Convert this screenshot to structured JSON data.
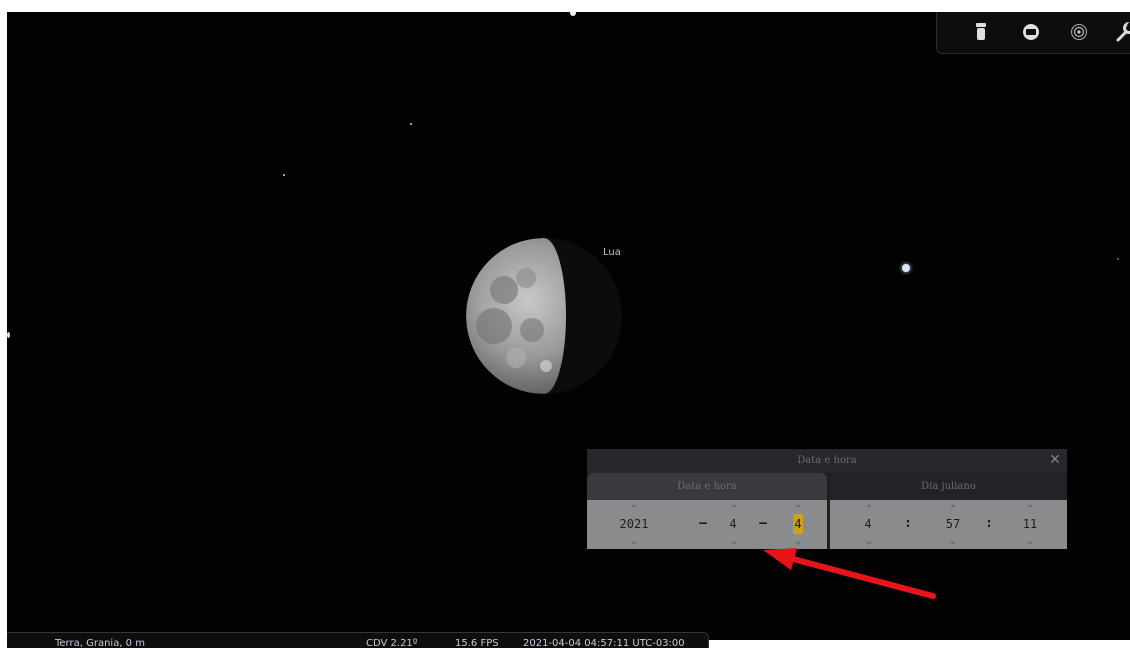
{
  "sky": {
    "moon_label": "Lua"
  },
  "toolbar": {
    "buttons": [
      {
        "icon": "lantern-icon"
      },
      {
        "icon": "ocular-icon"
      },
      {
        "icon": "telescope-target-icon"
      },
      {
        "icon": "wrench-icon"
      }
    ]
  },
  "dialog": {
    "title": "Data e hora",
    "close_label": "✕",
    "tabs": [
      {
        "label": "Data e hora",
        "active": true
      },
      {
        "label": "Dia juliano",
        "active": false
      }
    ],
    "date": {
      "year": "2021",
      "month": "4",
      "day": "4",
      "separator": "–"
    },
    "time": {
      "hour": "4",
      "minute": "57",
      "second": "11",
      "separator": ":"
    }
  },
  "statusbar": {
    "location": "Terra, Grania, 0 m",
    "fov": "CDV 2.21º",
    "fps": "15.6 FPS",
    "datetime": "2021-04-04 04:57:11 UTC-03:00"
  },
  "colors": {
    "sky": "#020203",
    "highlight": "#caa21e",
    "annotation_arrow": "#e8141a"
  }
}
